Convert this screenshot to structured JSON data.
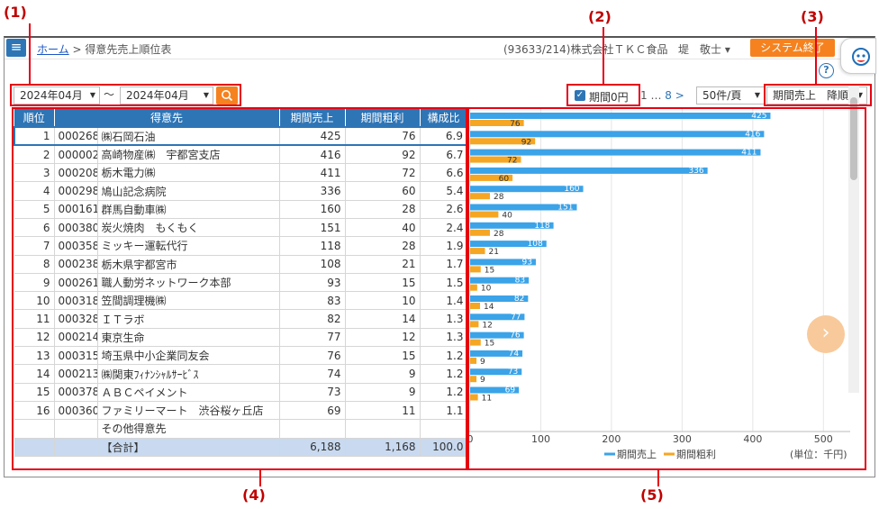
{
  "callouts": [
    "(1)",
    "(2)",
    "(3)",
    "(4)",
    "(5)"
  ],
  "header": {
    "breadcrumb_home": "ホーム",
    "breadcrumb_sep": ">",
    "breadcrumb_current": "得意先売上順位表",
    "company": "(93633/214)株式会社ＴＫＣ食品",
    "user": "堤　敬士 ▾",
    "system_end": "システム終了",
    "help": "?"
  },
  "controls": {
    "period_from": "2024年04月",
    "tilde": "〜",
    "period_to": "2024年04月",
    "zero_period_label": "期間0円",
    "zero_period_checked": true,
    "pager_first": "1",
    "pager_dots": "…",
    "pager_last": "8",
    "pager_next": ">",
    "per_page": "50件/頁",
    "sort": "期間売上　降順"
  },
  "table": {
    "headers": [
      "順位",
      "得意先",
      "期間売上",
      "期間粗利",
      "構成比"
    ],
    "rows": [
      [
        "1",
        "000268",
        "㈱石岡石油",
        "425",
        "76",
        "6.9"
      ],
      [
        "2",
        "000002",
        "高崎物産㈱　宇都宮支店",
        "416",
        "92",
        "6.7"
      ],
      [
        "3",
        "000208",
        "栃木電力㈱",
        "411",
        "72",
        "6.6"
      ],
      [
        "4",
        "000298",
        "鳩山記念病院",
        "336",
        "60",
        "5.4"
      ],
      [
        "5",
        "000161",
        "群馬自動車㈱",
        "160",
        "28",
        "2.6"
      ],
      [
        "6",
        "000380",
        "炭火焼肉　もくもく",
        "151",
        "40",
        "2.4"
      ],
      [
        "7",
        "000358",
        "ミッキー運転代行",
        "118",
        "28",
        "1.9"
      ],
      [
        "8",
        "000238",
        "栃木県宇都宮市",
        "108",
        "21",
        "1.7"
      ],
      [
        "9",
        "000261",
        "職人動労ネットワーク本部",
        "93",
        "15",
        "1.5"
      ],
      [
        "10",
        "000318",
        "笠間調理機㈱",
        "83",
        "10",
        "1.4"
      ],
      [
        "11",
        "000328",
        "ＩＴラボ",
        "82",
        "14",
        "1.3"
      ],
      [
        "12",
        "000214",
        "東京生命",
        "77",
        "12",
        "1.3"
      ],
      [
        "13",
        "000315",
        "埼玉県中小企業同友会",
        "76",
        "15",
        "1.2"
      ],
      [
        "14",
        "000213",
        "㈱関東ﾌｨﾅﾝｼｬﾙｻｰﾋﾞｽ",
        "74",
        "9",
        "1.2"
      ],
      [
        "15",
        "000378",
        "ＡＢＣペイメント",
        "73",
        "9",
        "1.2"
      ],
      [
        "16",
        "000360",
        "ファミリーマート　渋谷桜ヶ丘店",
        "69",
        "11",
        "1.1"
      ]
    ],
    "other_label": "その他得意先",
    "total": {
      "label": "【合計】",
      "sales": "6,188",
      "profit": "1,168",
      "ratio": "100.0"
    }
  },
  "chart_data": {
    "type": "bar",
    "orientation": "horizontal",
    "series": [
      {
        "name": "期間売上",
        "color": "#3ba3e8",
        "values": [
          425,
          416,
          411,
          336,
          160,
          151,
          118,
          108,
          93,
          83,
          82,
          77,
          76,
          74,
          73,
          69
        ]
      },
      {
        "name": "期間粗利",
        "color": "#f5a623",
        "values": [
          76,
          92,
          72,
          60,
          28,
          40,
          28,
          21,
          15,
          10,
          14,
          12,
          15,
          9,
          9,
          11
        ]
      }
    ],
    "xlim": [
      0,
      520
    ],
    "xticks": [
      0,
      100,
      200,
      300,
      400,
      500
    ],
    "unit_label": "(単位：千円)",
    "legend": "bottom",
    "grid": true
  }
}
